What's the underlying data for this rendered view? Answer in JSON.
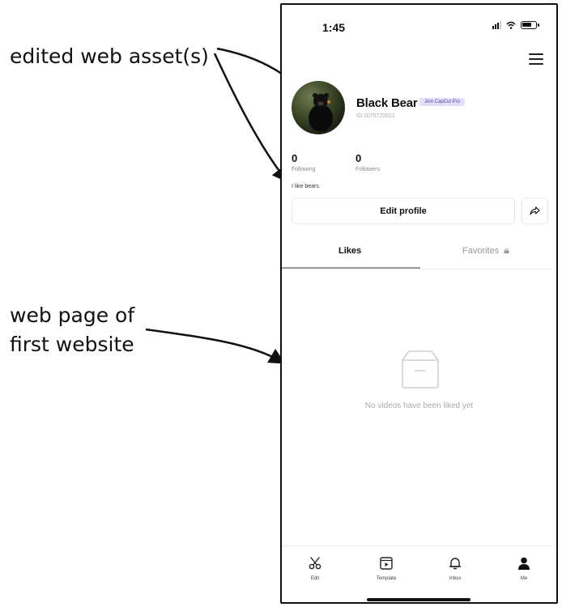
{
  "annotations": {
    "first": "edited web asset(s)",
    "second_line1": "web page of",
    "second_line2": "first website"
  },
  "status_bar": {
    "time": "1:45"
  },
  "profile": {
    "name": "Black Bear",
    "badge": "Join CapCut Pro",
    "id_text": "ID:1075720021",
    "following_count": "0",
    "following_label": "Following",
    "followers_count": "0",
    "followers_label": "Followers",
    "bio": "I like bears.",
    "edit_label": "Edit profile"
  },
  "tabs": {
    "likes": "Likes",
    "favorites": "Favorites"
  },
  "empty_state": {
    "message": "No videos have been liked yet"
  },
  "bottom_nav": {
    "edit": "Edit",
    "template": "Template",
    "inbox": "Inbox",
    "me": "Me"
  }
}
